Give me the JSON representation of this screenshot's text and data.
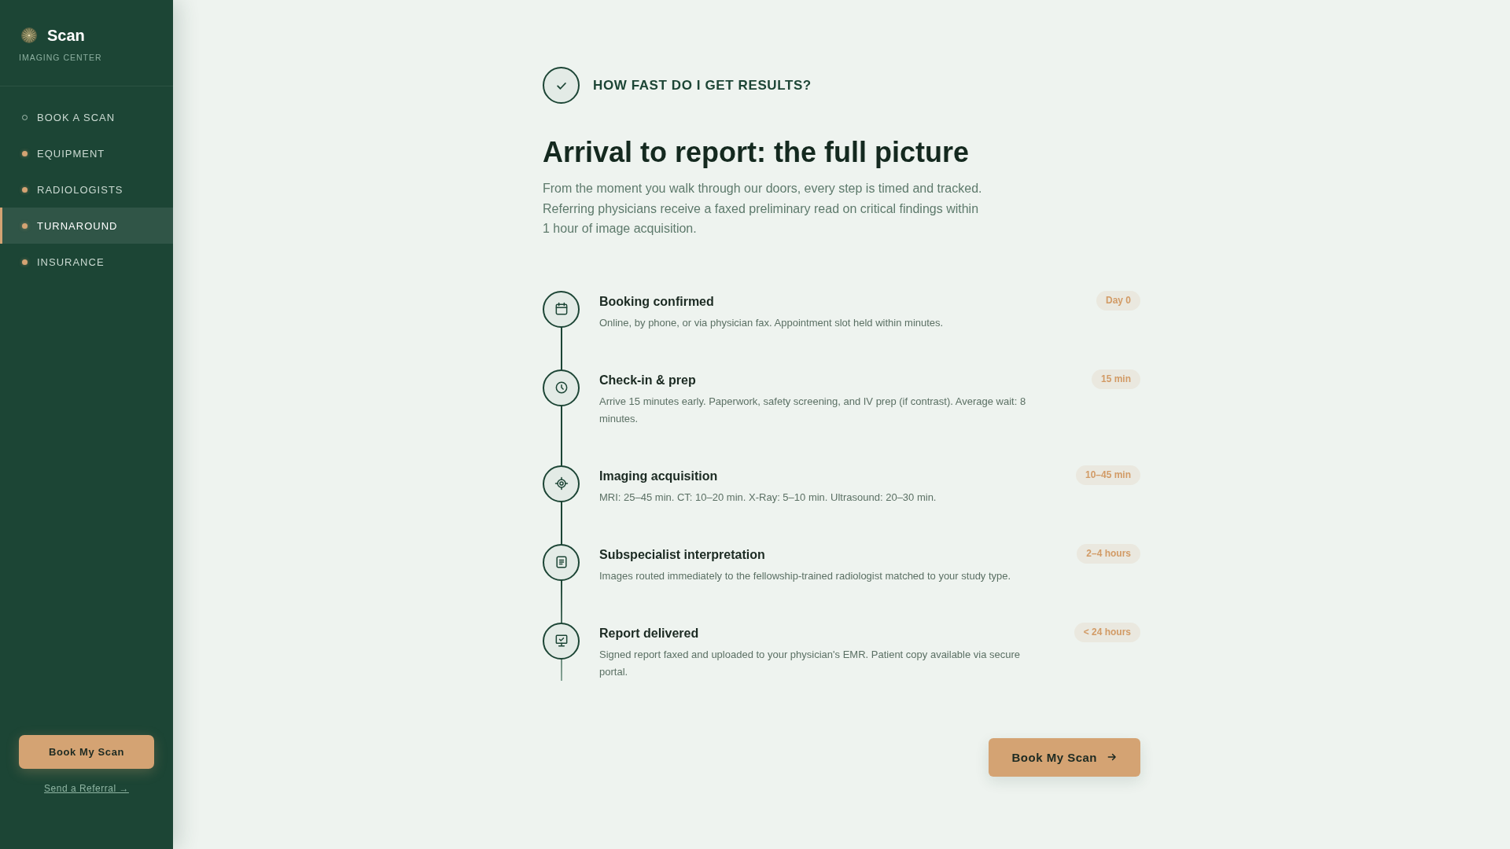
{
  "sidebar": {
    "brand": {
      "name": "Scan",
      "subtitle": "IMAGING CENTER"
    },
    "nav": [
      {
        "label": "BOOK A SCAN",
        "kind": "ring",
        "selected": false
      },
      {
        "label": "EQUIPMENT",
        "kind": "dot",
        "selected": false
      },
      {
        "label": "RADIOLOGISTS",
        "kind": "dot",
        "selected": false
      },
      {
        "label": "TURNAROUND",
        "kind": "dot",
        "selected": true
      },
      {
        "label": "INSURANCE",
        "kind": "dot",
        "selected": false
      }
    ],
    "button": "Book My Scan",
    "link": "Send a Referral →"
  },
  "main": {
    "eyebrow": "HOW FAST DO I GET RESULTS?",
    "heading": "Arrival to report: the full picture",
    "intro": "From the moment you walk through our doors, every step is timed and tracked. Referring physicians receive a faxed preliminary read on critical findings within 1 hour of image acquisition.",
    "steps": [
      {
        "title": "Booking confirmed",
        "description": "Online, by phone, or via physician fax. Appointment slot held within minutes.",
        "duration": "Day 0"
      },
      {
        "title": "Check-in & prep",
        "description": "Arrive 15 minutes early. Paperwork, safety screening, and IV prep (if contrast). Average wait: 8 minutes.",
        "duration": "15 min"
      },
      {
        "title": "Imaging acquisition",
        "description": "MRI: 25–45 min. CT: 10–20 min. X-Ray: 5–10 min. Ultrasound: 20–30 min.",
        "duration": "10–45 min"
      },
      {
        "title": "Subspecialist interpretation",
        "description": "Images routed immediately to the fellowship-trained radiologist matched to your study type.",
        "duration": "2–4 hours"
      },
      {
        "title": "Report delivered",
        "description": "Signed report faxed and uploaded to your physician's EMR. Patient copy available via secure portal.",
        "duration": "< 24 hours"
      }
    ],
    "button": "Book My Scan"
  }
}
